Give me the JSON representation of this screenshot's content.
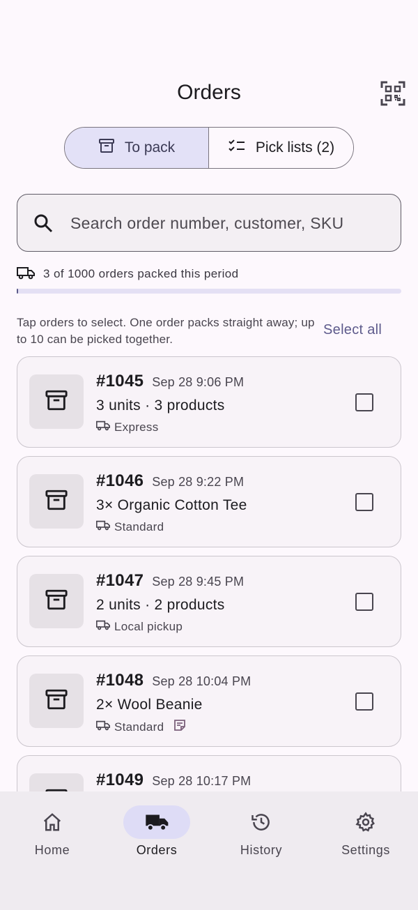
{
  "header": {
    "title": "Orders",
    "qr_icon": "qr-code-scanner-icon"
  },
  "segments": [
    {
      "label": "To pack",
      "icon": "archive-icon",
      "selected": true
    },
    {
      "label": "Pick lists (2)",
      "icon": "checklist-icon",
      "selected": false
    }
  ],
  "search": {
    "placeholder": "Search order number, customer, SKU",
    "value": ""
  },
  "packed": {
    "text": "3 of 1000 orders packed this period",
    "progress_fraction": 0.003
  },
  "selection": {
    "hint": "Tap orders to select. One order packs straight away; up to 10 can be picked together.",
    "select_all": "Select all"
  },
  "orders": [
    {
      "number": "#1045",
      "date": "Sep 28 9:06 PM",
      "summary": "3 units · 3 products",
      "shipping": "Express",
      "has_note": false,
      "checked": false
    },
    {
      "number": "#1046",
      "date": "Sep 28 9:22 PM",
      "summary": "3× Organic Cotton Tee",
      "shipping": "Standard",
      "has_note": false,
      "checked": false
    },
    {
      "number": "#1047",
      "date": "Sep 28 9:45 PM",
      "summary": "2 units · 2 products",
      "shipping": "Local pickup",
      "has_note": false,
      "checked": false
    },
    {
      "number": "#1048",
      "date": "Sep 28 10:04 PM",
      "summary": "2× Wool Beanie",
      "shipping": "Standard",
      "has_note": true,
      "checked": false
    },
    {
      "number": "#1049",
      "date": "Sep 28 10:17 PM",
      "summary": "",
      "shipping": "",
      "has_note": false,
      "checked": false
    }
  ],
  "nav": [
    {
      "label": "Home",
      "icon": "home-icon",
      "active": false
    },
    {
      "label": "Orders",
      "icon": "truck-icon",
      "active": true
    },
    {
      "label": "History",
      "icon": "history-icon",
      "active": false
    },
    {
      "label": "Settings",
      "icon": "gear-icon",
      "active": false
    }
  ],
  "colors": {
    "accent": "#5d5a8b",
    "segment_selected_bg": "#e3e1f7",
    "nav_active_bg": "#dedcf6"
  }
}
